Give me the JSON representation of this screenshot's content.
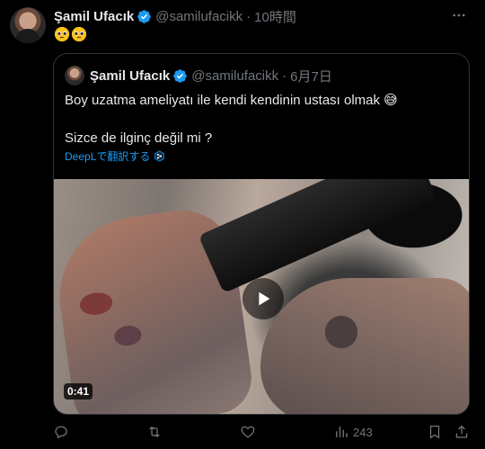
{
  "post": {
    "author_name": "Şamil Ufacık",
    "author_handle": "@samilufacikk",
    "separator": "·",
    "time": "10時間",
    "emoji_text": "🥹🥹"
  },
  "quoted": {
    "author_name": "Şamil Ufacık",
    "author_handle": "@samilufacikk",
    "separator": "·",
    "time": "6月7日",
    "line1": "Boy uzatma ameliyatı ile kendi kendinin ustası olmak 😅",
    "line2": "Sizce de ilginç değil mi ?",
    "translate_label": "DeepLで翻訳する",
    "video_duration": "0:41"
  },
  "actions": {
    "views_count": "243"
  },
  "colors": {
    "background": "#000000",
    "text": "#e7e9ea",
    "muted": "#71767b",
    "link": "#1d9bf0",
    "verified": "#1d9bf0",
    "border": "#2f3336"
  }
}
